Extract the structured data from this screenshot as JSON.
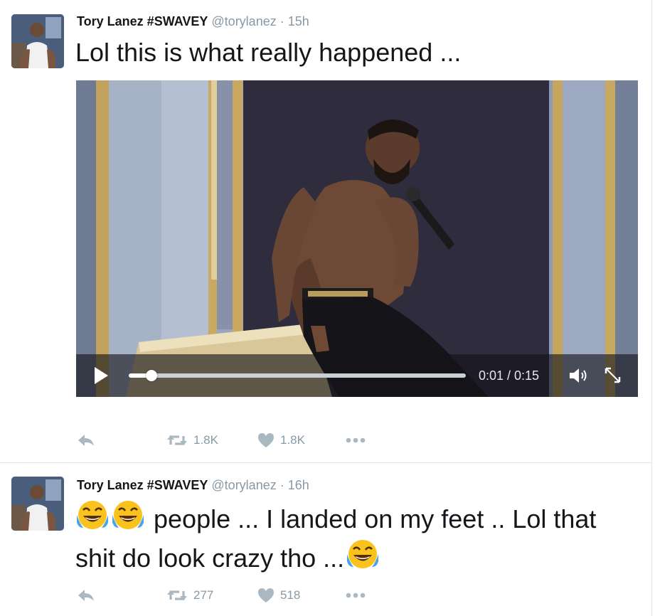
{
  "tweets": [
    {
      "author": {
        "name": "Tory Lanez #SWAVEY",
        "handle": "@torylanez",
        "separator": "·",
        "time": "15h"
      },
      "text": "Lol this is what really happened ...",
      "video": {
        "time_display": "0:01 / 0:15",
        "progress": 0.067
      },
      "actions": {
        "retweets": "1.8K",
        "likes": "1.8K"
      }
    },
    {
      "author": {
        "name": "Tory Lanez #SWAVEY",
        "handle": "@torylanez",
        "separator": "·",
        "time": "16h"
      },
      "text_parts": [
        "people ... I landed on my feet .. Lol that shit do look crazy tho ..."
      ],
      "emoji": [
        "face-with-tears-of-joy",
        "face-with-tears-of-joy",
        "face-with-tears-of-joy"
      ],
      "actions": {
        "retweets": "277",
        "likes": "518"
      }
    }
  ],
  "icons": {
    "reply": "reply-icon",
    "retweet": "retweet-icon",
    "like": "heart-icon",
    "more": "more-icon",
    "play": "play-icon",
    "volume": "volume-icon",
    "expand": "expand-icon"
  },
  "colors": {
    "text": "#14171a",
    "muted": "#8899a6",
    "divider": "#e1e8ed"
  }
}
